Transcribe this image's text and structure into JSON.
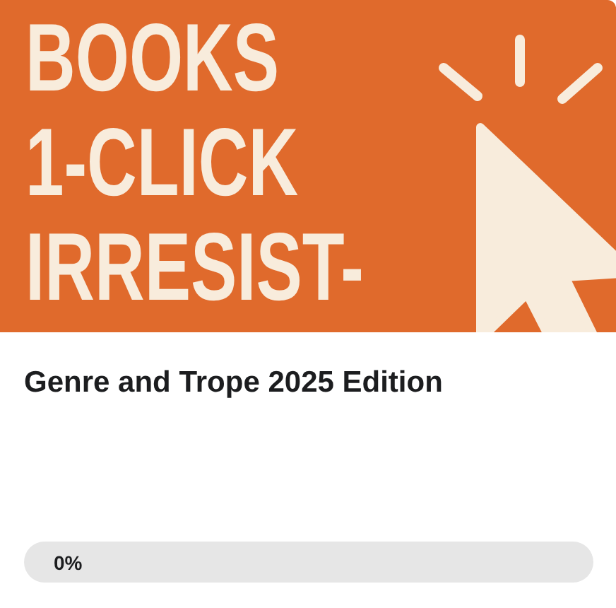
{
  "thumbnail": {
    "lines": [
      "BOOKS",
      "1-CLICK",
      "IRRESIST-"
    ]
  },
  "title": "Genre and Trope 2025 Edition",
  "progress": {
    "level": 0,
    "reading": "0%"
  }
}
